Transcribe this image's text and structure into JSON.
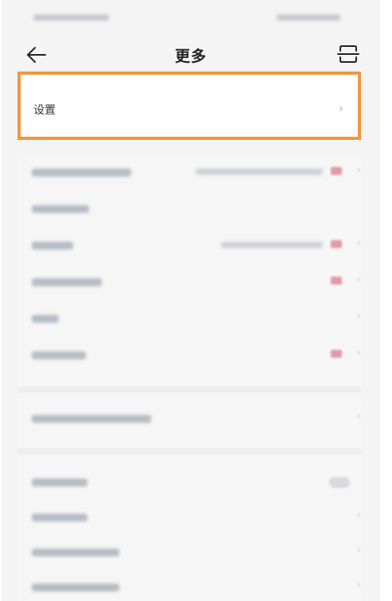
{
  "header": {
    "title": "更多",
    "back_icon": "back-arrow-icon",
    "scan_icon": "scan-icon"
  },
  "settings": {
    "label": "设置",
    "chevron": "›"
  },
  "list": {
    "chevron": "›"
  },
  "colors": {
    "highlight": "#f0963f",
    "background": "#f4f4f4"
  }
}
